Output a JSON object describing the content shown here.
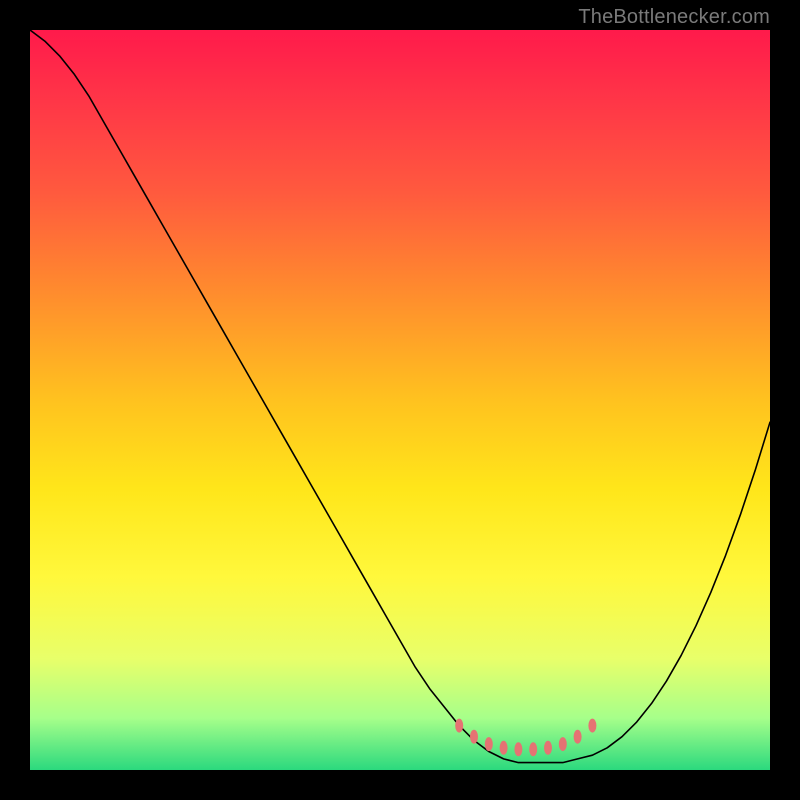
{
  "attribution": "TheBottlenecker.com",
  "chart_data": {
    "type": "line",
    "title": "",
    "xlabel": "",
    "ylabel": "",
    "xlim": [
      0,
      100
    ],
    "ylim": [
      0,
      100
    ],
    "grid": false,
    "series": [
      {
        "name": "curve",
        "stroke": "#000000",
        "stroke_width": 1.6,
        "x": [
          0,
          2,
          4,
          6,
          8,
          10,
          12,
          14,
          16,
          18,
          20,
          22,
          24,
          26,
          28,
          30,
          32,
          34,
          36,
          38,
          40,
          42,
          44,
          46,
          48,
          50,
          52,
          54,
          56,
          58,
          60,
          62,
          64,
          66,
          68,
          70,
          72,
          74,
          76,
          78,
          80,
          82,
          84,
          86,
          88,
          90,
          92,
          94,
          96,
          98,
          100
        ],
        "values": [
          100,
          98.5,
          96.5,
          94,
          91,
          87.5,
          84,
          80.5,
          77,
          73.5,
          70,
          66.5,
          63,
          59.5,
          56,
          52.5,
          49,
          45.5,
          42,
          38.5,
          35,
          31.5,
          28,
          24.5,
          21,
          17.5,
          14,
          11,
          8.5,
          6,
          4,
          2.5,
          1.5,
          1,
          1,
          1,
          1,
          1.5,
          2,
          3,
          4.5,
          6.5,
          9,
          12,
          15.5,
          19.5,
          24,
          29,
          34.5,
          40.5,
          47
        ]
      },
      {
        "name": "optimal-zone-markers",
        "type": "scatter",
        "stroke": "#e57373",
        "fill": "#e57373",
        "marker_rx": 4,
        "marker_ry": 7,
        "x": [
          58,
          60,
          62,
          64,
          66,
          68,
          70,
          72,
          74,
          76
        ],
        "values": [
          6,
          4.5,
          3.5,
          3,
          2.8,
          2.8,
          3,
          3.5,
          4.5,
          6
        ]
      }
    ],
    "background_gradient": {
      "stops": [
        {
          "offset": 0.0,
          "color": "#ff1a4b"
        },
        {
          "offset": 0.1,
          "color": "#ff3747"
        },
        {
          "offset": 0.22,
          "color": "#ff5a3e"
        },
        {
          "offset": 0.35,
          "color": "#ff8a2e"
        },
        {
          "offset": 0.5,
          "color": "#ffc21f"
        },
        {
          "offset": 0.62,
          "color": "#ffe61a"
        },
        {
          "offset": 0.74,
          "color": "#fff83c"
        },
        {
          "offset": 0.85,
          "color": "#e8ff6a"
        },
        {
          "offset": 0.93,
          "color": "#a6ff8a"
        },
        {
          "offset": 1.0,
          "color": "#2bd97e"
        }
      ]
    }
  }
}
